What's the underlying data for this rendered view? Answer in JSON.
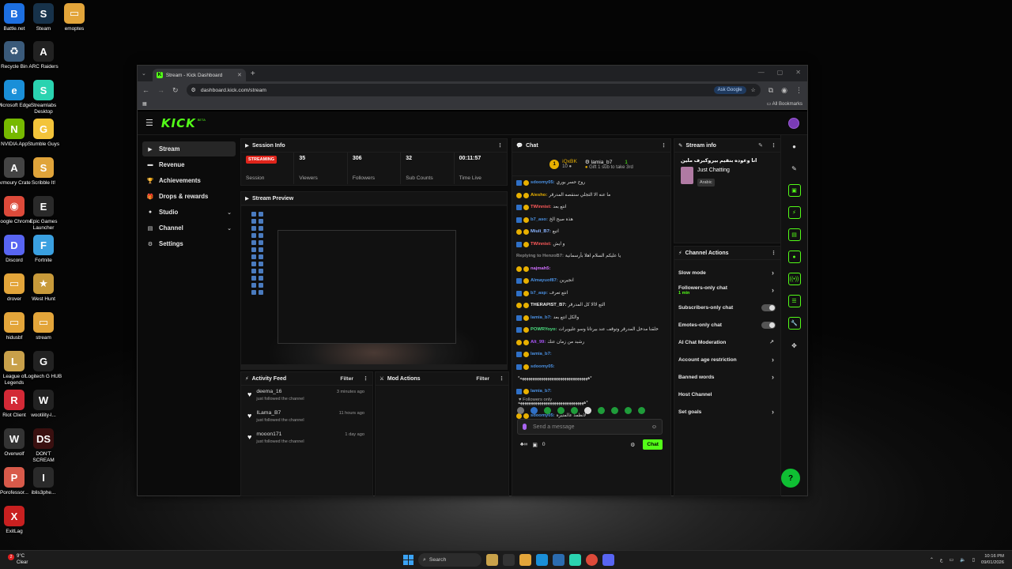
{
  "desktop": {
    "icons": [
      {
        "label": "Battle.net",
        "glyph": "B",
        "color": "#1d6fe0"
      },
      {
        "label": "Steam",
        "glyph": "S",
        "color": "#17324a"
      },
      {
        "label": "emoptes",
        "glyph": "▭",
        "color": "#e3a53a"
      },
      {
        "label": "Recycle Bin",
        "glyph": "♻",
        "color": "#3a5a7a"
      },
      {
        "label": "ARC Raiders",
        "glyph": "A",
        "color": "#222222"
      },
      {
        "label": "Microsoft Edge",
        "glyph": "e",
        "color": "#1a8fd8"
      },
      {
        "label": "Streamlabs Desktop",
        "glyph": "S",
        "color": "#2ad3b0"
      },
      {
        "label": "NVIDIA App",
        "glyph": "N",
        "color": "#76b900"
      },
      {
        "label": "Stumble Guys",
        "glyph": "G",
        "color": "#f3c43a"
      },
      {
        "label": "Armoury Crate",
        "glyph": "A",
        "color": "#444444"
      },
      {
        "label": "Scribble It!",
        "glyph": "S",
        "color": "#e0a43a"
      },
      {
        "label": "Google Chrome",
        "glyph": "◉",
        "color": "#dd4a3a"
      },
      {
        "label": "Epic Games Launcher",
        "glyph": "E",
        "color": "#2a2a2a"
      },
      {
        "label": "Discord",
        "glyph": "D",
        "color": "#5865f2"
      },
      {
        "label": "Fortnite",
        "glyph": "F",
        "color": "#3aa0e0"
      },
      {
        "label": "drover",
        "glyph": "▭",
        "color": "#e3a53a"
      },
      {
        "label": "West Hunt",
        "glyph": "★",
        "color": "#c89a3a"
      },
      {
        "label": "hidusbf",
        "glyph": "▭",
        "color": "#e3a53a"
      },
      {
        "label": "stream",
        "glyph": "▭",
        "color": "#e3a53a"
      },
      {
        "label": "League of Legends",
        "glyph": "L",
        "color": "#c8a04a"
      },
      {
        "label": "Logitech G HUB",
        "glyph": "G",
        "color": "#222222"
      },
      {
        "label": "Riot Client",
        "glyph": "R",
        "color": "#d32936"
      },
      {
        "label": "wootility-l...",
        "glyph": "W",
        "color": "#222222"
      },
      {
        "label": "Overwolf",
        "glyph": "W",
        "color": "#333333"
      },
      {
        "label": "DON'T SCREAM",
        "glyph": "DS",
        "color": "#3a1010"
      },
      {
        "label": "Porofessor...",
        "glyph": "P",
        "color": "#d85a4a"
      },
      {
        "label": "iblis3phe...",
        "glyph": "I",
        "color": "#2a2a2a"
      },
      {
        "label": "ExitLag",
        "glyph": "X",
        "color": "#c82020"
      }
    ]
  },
  "browser": {
    "tab_title": "Stream - Kick Dashboard",
    "url": "dashboard.kick.com/stream",
    "ask_google": "Ask Google",
    "all_bookmarks": "All Bookmarks"
  },
  "kick": {
    "logo": "KICK",
    "beta": "BETA",
    "nav": [
      {
        "label": "Stream",
        "icon": "▶"
      },
      {
        "label": "Revenue",
        "icon": "▬"
      },
      {
        "label": "Achievements",
        "icon": "🏆"
      },
      {
        "label": "Drops & rewards",
        "icon": "🎁"
      },
      {
        "label": "Studio",
        "icon": "●"
      },
      {
        "label": "Channel",
        "icon": "▤"
      },
      {
        "label": "Settings",
        "icon": "⚙"
      }
    ],
    "session": {
      "title": "Session Info",
      "badge": "STREAMING",
      "session_label": "Session",
      "viewers": "35",
      "viewers_label": "Viewers",
      "followers": "306",
      "followers_label": "Followers",
      "subs": "32",
      "subs_label": "Sub Counts",
      "time": "00:11:57",
      "time_label": "Time Live"
    },
    "preview_title": "Stream Preview",
    "activity": {
      "title": "Activity Feed",
      "filter": "Filter",
      "items": [
        {
          "name": "deema_16",
          "action": "just followed the channel",
          "ago": "3 minutes ago"
        },
        {
          "name": "ILama_B7",
          "action": "just followed the channel",
          "ago": "11 hours ago"
        },
        {
          "name": "mooon171",
          "action": "just followed the channel",
          "ago": "1 day ago"
        }
      ]
    },
    "mod": {
      "title": "Mod Actions",
      "filter": "Filter"
    },
    "chat": {
      "title": "Chat",
      "pin_user": "iQxBK",
      "pin_count": "10",
      "pin_target": "lamia_b7",
      "pin_num": "1",
      "pin_note": "Gift 1 sub to take 3rd",
      "messages": [
        {
          "user": "sdoomy05:",
          "text": "روح حسر بوري",
          "color": "#4a90e2"
        },
        {
          "user": "Aiesho:",
          "text": "ما عنه الا التجلي سنقصه المدرقر",
          "color": "#e8b000"
        },
        {
          "user": "TWinnist:",
          "text": "انتع بعد",
          "color": "#ff5a5a"
        },
        {
          "user": "b7_aso:",
          "text": "هذه صبح الخ",
          "color": "#4a90e2"
        },
        {
          "user": "Miuli_B7:",
          "text": "اتيع",
          "color": "#8ab4ff"
        },
        {
          "user": "TWinnist:",
          "text": "و ايش",
          "color": "#ff5a5a"
        },
        {
          "user": "Replying to HenzoB7:",
          "text": "يا عليكم السلام اهلا بأرسمانية",
          "color": "#888888"
        },
        {
          "user": "najmah5:",
          "text": "",
          "color": "#d070ff"
        },
        {
          "user": "Almayuof87:",
          "text": "انجيرين",
          "color": "#4a90e2"
        },
        {
          "user": "b7_asp:",
          "text": "انتع تعرف",
          "color": "#4a90e2"
        },
        {
          "user": "THERAPIST_B7:",
          "text": "التع لاالا كل المدرقر",
          "color": "#eeeeee"
        },
        {
          "user": "lamia_b7:",
          "text": "والكل انتع بعد",
          "color": "#4a90e2"
        },
        {
          "user": "POWRYoyo:",
          "text": "خلقنا مدخل المدرقر وتوقف عند بيرتانا وسو عليوبرات",
          "color": "#4ade80"
        },
        {
          "user": "Alt_99:",
          "text": "رشبد من زمان عنك",
          "color": "#a855f7"
        },
        {
          "user": "lamia_b7:",
          "text": "",
          "color": "#4a90e2"
        },
        {
          "user": "sdoomy05:",
          "text": "",
          "color": "#4a90e2"
        },
        {
          "user": "",
          "text": "*ههههههههههههههههههههههههههههههههه*",
          "color": "#dddddd"
        },
        {
          "user": "lamia_b7:",
          "text": "",
          "color": "#4a90e2"
        },
        {
          "user": "",
          "text": "هههههههههههههههههههههههههههههههه*",
          "color": "#dddddd"
        },
        {
          "user": "sdoomy05:",
          "text": "لانظمد عالمنيره",
          "color": "#4a90e2"
        },
        {
          "user": "Miuli_B7:",
          "text": "*ههههههههههههه*",
          "color": "#8ab4ff"
        }
      ],
      "followers_only": "Followers only",
      "placeholder": "Send a message",
      "count": "0",
      "send": "Chat"
    },
    "stream_info": {
      "title": "Stream info",
      "stream_title": "انا وعوده بنقيم بيروكبرف ملين",
      "category": "Just Chatting",
      "tag": "Arabic"
    },
    "channel_actions": {
      "title": "Channel Actions",
      "items": [
        {
          "label": "Slow mode",
          "sub": "",
          "type": "chevron"
        },
        {
          "label": "Followers-only chat",
          "sub": "1 min",
          "type": "chevron"
        },
        {
          "label": "Subscribers-only chat",
          "sub": "",
          "type": "toggle"
        },
        {
          "label": "Emotes-only chat",
          "sub": "",
          "type": "toggle"
        },
        {
          "label": "AI Chat Moderation",
          "sub": "",
          "type": "external"
        },
        {
          "label": "Account age restriction",
          "sub": "",
          "type": "chevron"
        },
        {
          "label": "Banned words",
          "sub": "",
          "type": "chevron"
        },
        {
          "label": "Host Channel",
          "sub": "",
          "type": "none"
        },
        {
          "label": "Set goals",
          "sub": "",
          "type": "chevron"
        }
      ]
    }
  },
  "taskbar": {
    "temp": "9°C",
    "weather": "Clear",
    "search": "Search",
    "lang": "ع",
    "time": "10:16 PM",
    "date": "09/01/2026"
  }
}
